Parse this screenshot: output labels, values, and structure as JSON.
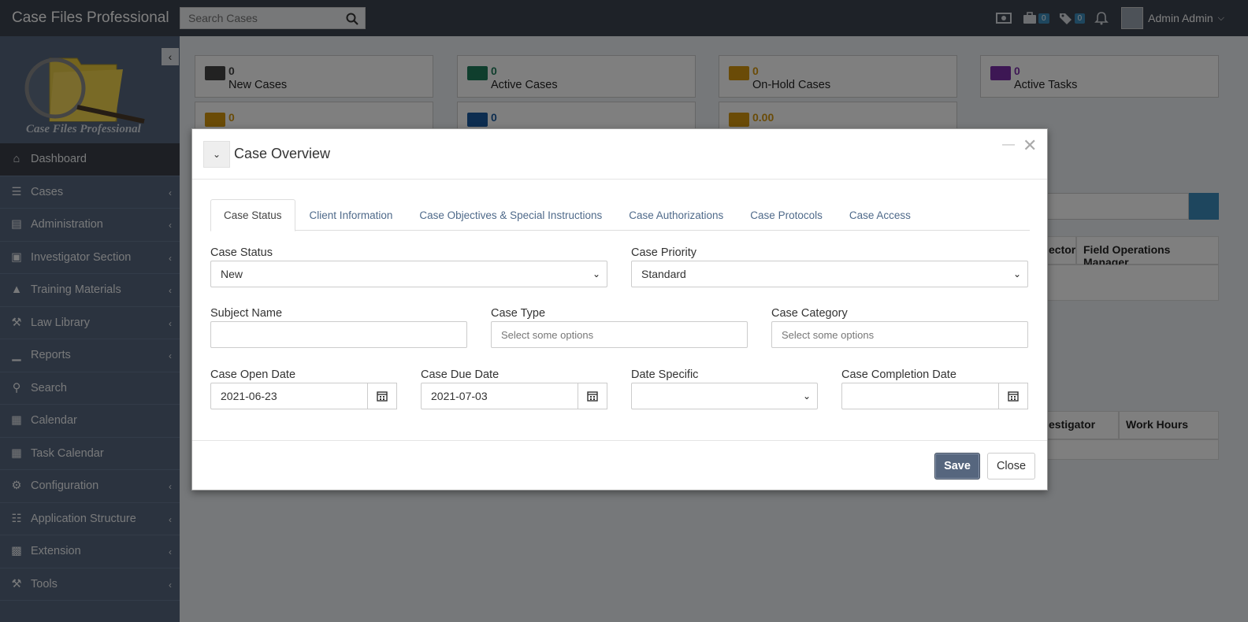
{
  "app": {
    "title": "Case Files Professional",
    "search_placeholder": "Search Cases",
    "badges": {
      "cases": "0",
      "tags": "0"
    },
    "user_name": "Admin Admin"
  },
  "sidebar": {
    "logo_text": "Case Files Professional",
    "items": [
      {
        "label": "Dashboard",
        "icon": "home-icon",
        "active": true,
        "has_submenu": false
      },
      {
        "label": "Cases",
        "icon": "database-icon",
        "has_submenu": true
      },
      {
        "label": "Administration",
        "icon": "book-icon",
        "has_submenu": true
      },
      {
        "label": "Investigator Section",
        "icon": "briefcase-icon",
        "has_submenu": true
      },
      {
        "label": "Training Materials",
        "icon": "graduation-cap-icon",
        "has_submenu": true
      },
      {
        "label": "Law Library",
        "icon": "gavel-icon",
        "has_submenu": true
      },
      {
        "label": "Reports",
        "icon": "bar-chart-icon",
        "has_submenu": true
      },
      {
        "label": "Search",
        "icon": "search-icon",
        "has_submenu": false
      },
      {
        "label": "Calendar",
        "icon": "calendar-icon",
        "has_submenu": false
      },
      {
        "label": "Task Calendar",
        "icon": "calendar-icon",
        "has_submenu": false
      },
      {
        "label": "Configuration",
        "icon": "gear-icon",
        "has_submenu": true
      },
      {
        "label": "Application Structure",
        "icon": "sitemap-icon",
        "has_submenu": true
      },
      {
        "label": "Extension",
        "icon": "puzzle-icon",
        "has_submenu": true
      },
      {
        "label": "Tools",
        "icon": "wrench-icon",
        "has_submenu": true
      }
    ]
  },
  "dashboard": {
    "stats": [
      {
        "value": "0",
        "label": "New Cases",
        "color": "#444444",
        "icon": "newspaper-icon"
      },
      {
        "value": "0",
        "label": "Active Cases",
        "color": "#1e7c5a",
        "icon": "ordered-list-icon"
      },
      {
        "value": "0",
        "label": "On-Hold Cases",
        "color": "#d4960f",
        "icon": "briefcase-icon"
      },
      {
        "value": "0",
        "label": "Active Tasks",
        "color": "#7b2fa8",
        "icon": "tasks-icon"
      },
      {
        "value": "0",
        "label": "",
        "color": "#d4960f",
        "icon": "pin-icon"
      },
      {
        "value": "0",
        "label": "",
        "color": "#1a5aa0",
        "icon": "envelope-icon"
      },
      {
        "value": "0.00",
        "label": "",
        "color": "#d4960f",
        "icon": "dollar-icon"
      }
    ],
    "table1_headers": [
      "ector",
      "Field Operations Manager"
    ],
    "table2_headers": [
      "estigator",
      "Work Hours"
    ]
  },
  "modal": {
    "title": "Case Overview",
    "tabs": [
      "Case Status",
      "Client Information",
      "Case Objectives & Special Instructions",
      "Case Authorizations",
      "Case Protocols",
      "Case Access"
    ],
    "active_tab": "Case Status",
    "fields": {
      "case_status": {
        "label": "Case Status",
        "value": "New"
      },
      "case_priority": {
        "label": "Case Priority",
        "value": "Standard"
      },
      "subject_name": {
        "label": "Subject Name",
        "value": ""
      },
      "case_type": {
        "label": "Case Type",
        "placeholder": "Select some options"
      },
      "case_category": {
        "label": "Case Category",
        "placeholder": "Select some options"
      },
      "case_open_date": {
        "label": "Case Open Date",
        "value": "2021-06-23"
      },
      "case_due_date": {
        "label": "Case Due Date",
        "value": "2021-07-03"
      },
      "date_specific": {
        "label": "Date Specific",
        "value": ""
      },
      "case_completion_date": {
        "label": "Case Completion Date",
        "value": ""
      }
    },
    "save_label": "Save",
    "close_label": "Close"
  }
}
